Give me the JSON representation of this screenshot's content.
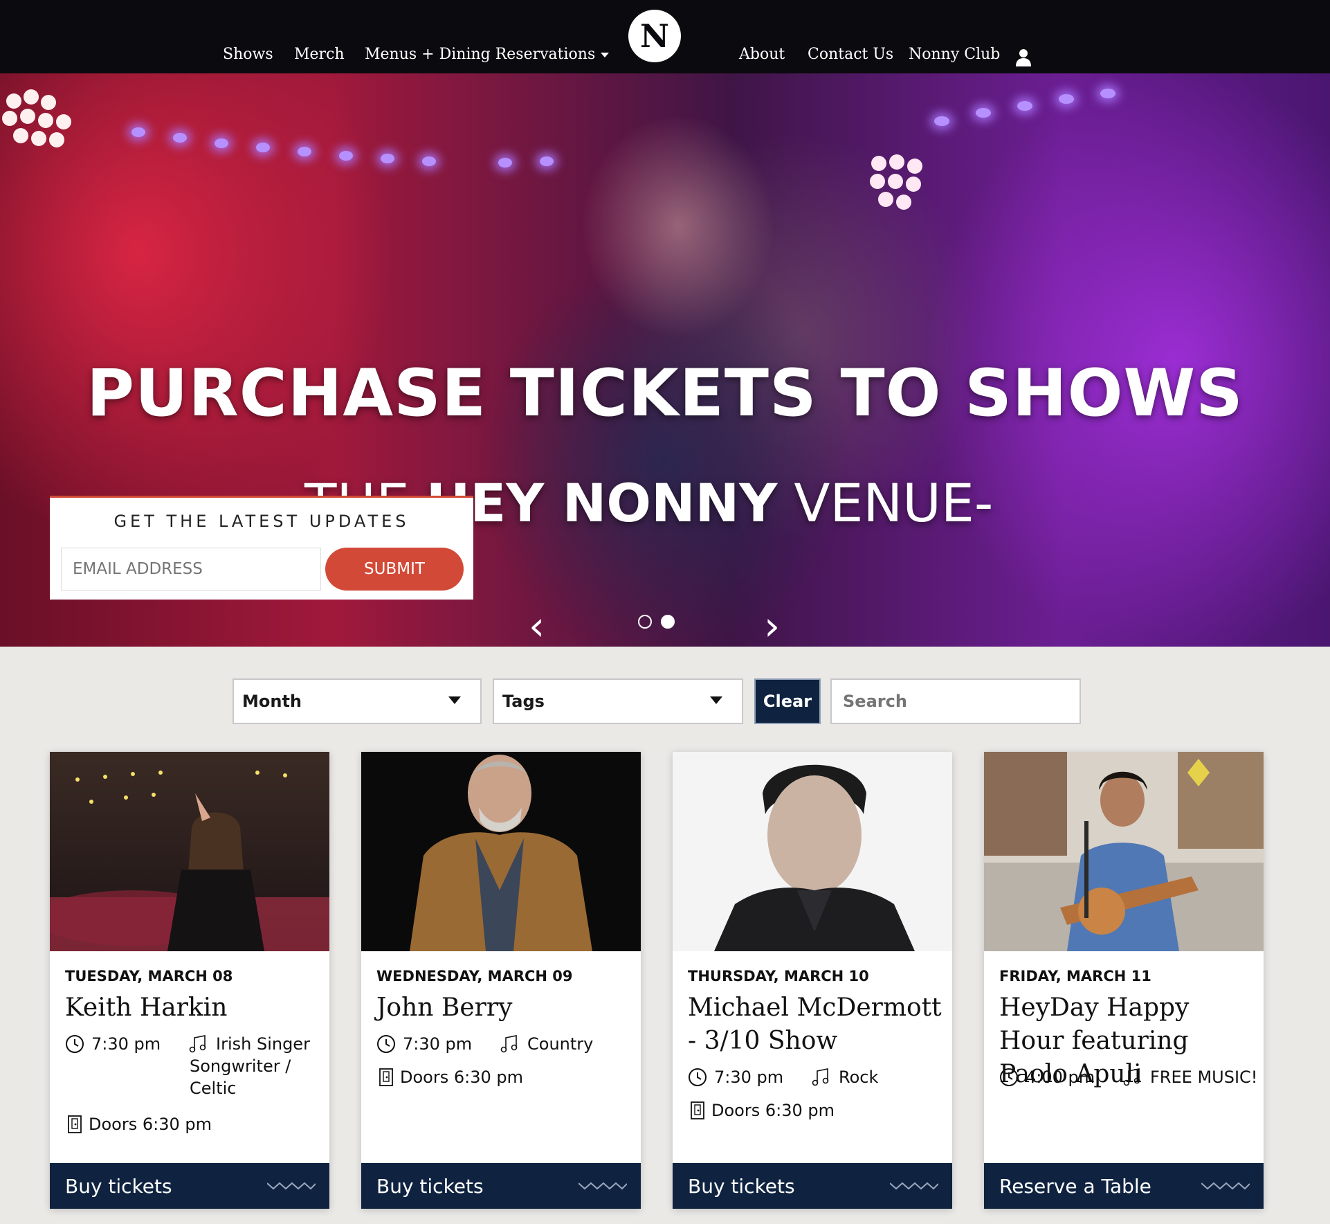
{
  "nav": {
    "left": [
      "Shows",
      "Merch",
      "Menus + Dining Reservations"
    ],
    "logo": "N",
    "right": [
      "About",
      "Contact Us",
      "Nonny Club"
    ]
  },
  "hero": {
    "title": "PURCHASE TICKETS TO SHOWS",
    "subtitle_prefix": "THE ",
    "subtitle_bold": "HEY NONNY",
    "subtitle_suffix": " VENUE-",
    "prev_icon": "chevron-left-icon",
    "next_icon": "chevron-right-icon",
    "slide_count": 2,
    "active_slide": 2
  },
  "signup": {
    "title": "GET THE LATEST UPDATES",
    "placeholder": "EMAIL ADDRESS",
    "submit": "SUBMIT"
  },
  "filters": {
    "month": "Month",
    "tags": "Tags",
    "clear": "Clear",
    "search_placeholder": "Search"
  },
  "events": [
    {
      "date": "TUESDAY, MARCH 08",
      "title": "Keith Harkin",
      "time": "7:30 pm",
      "tag": "Irish Singer Songwriter / Celtic",
      "doors": "Doors 6:30 pm",
      "action": "Buy tickets"
    },
    {
      "date": "WEDNESDAY, MARCH 09",
      "title": "John Berry",
      "time": "7:30 pm",
      "tag": "Country",
      "doors": "Doors 6:30 pm",
      "action": "Buy tickets"
    },
    {
      "date": "THURSDAY, MARCH 10",
      "title": "Michael McDermott - 3/10 Show",
      "time": "7:30 pm",
      "tag": "Rock",
      "doors": "Doors 6:30 pm",
      "action": "Buy tickets"
    },
    {
      "date": "FRIDAY, MARCH 11",
      "title": "HeyDay Happy Hour featuring Paolo Apuli",
      "time": "4:00 pm",
      "tag": "FREE MUSIC!",
      "doors": "",
      "action": "Reserve a Table"
    }
  ],
  "colors": {
    "nav_bg": "#0b0a0e",
    "accent": "#d24a37",
    "navy": "#0f2340",
    "page_bg": "#ebe9e6"
  }
}
